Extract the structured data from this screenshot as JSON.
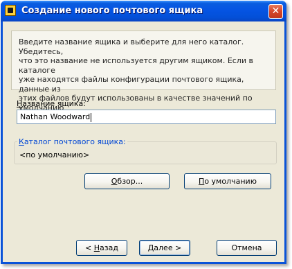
{
  "window": {
    "title": "Создание нового почтового ящика",
    "close_glyph": "✕"
  },
  "description": "Введите название ящика и выберите для него каталог. Убедитесь,\nчто это название не используется другим ящиком. Если в каталоге\nуже находятся файлы конфигурации почтового ящика, данные из\nэтих файлов будут использованы в качестве значений по умолчанию\nдля последующих шагов.",
  "name_field": {
    "label_mnemonic": "Н",
    "label_rest": "азвание ящика:",
    "value": "Nathan Woodward"
  },
  "catalog": {
    "label_mnemonic": "К",
    "label_rest": "аталог почтового ящика:",
    "value": "<по умолчанию>"
  },
  "buttons": {
    "browse_mnemonic": "О",
    "browse_rest": "бзор...",
    "default_mnemonic": "П",
    "default_rest": "о умолчанию",
    "back_prefix": "< ",
    "back_mnemonic": "Н",
    "back_rest": "азад",
    "next_mnemonic": "Д",
    "next_rest": "алее >",
    "cancel": "Отмена"
  }
}
